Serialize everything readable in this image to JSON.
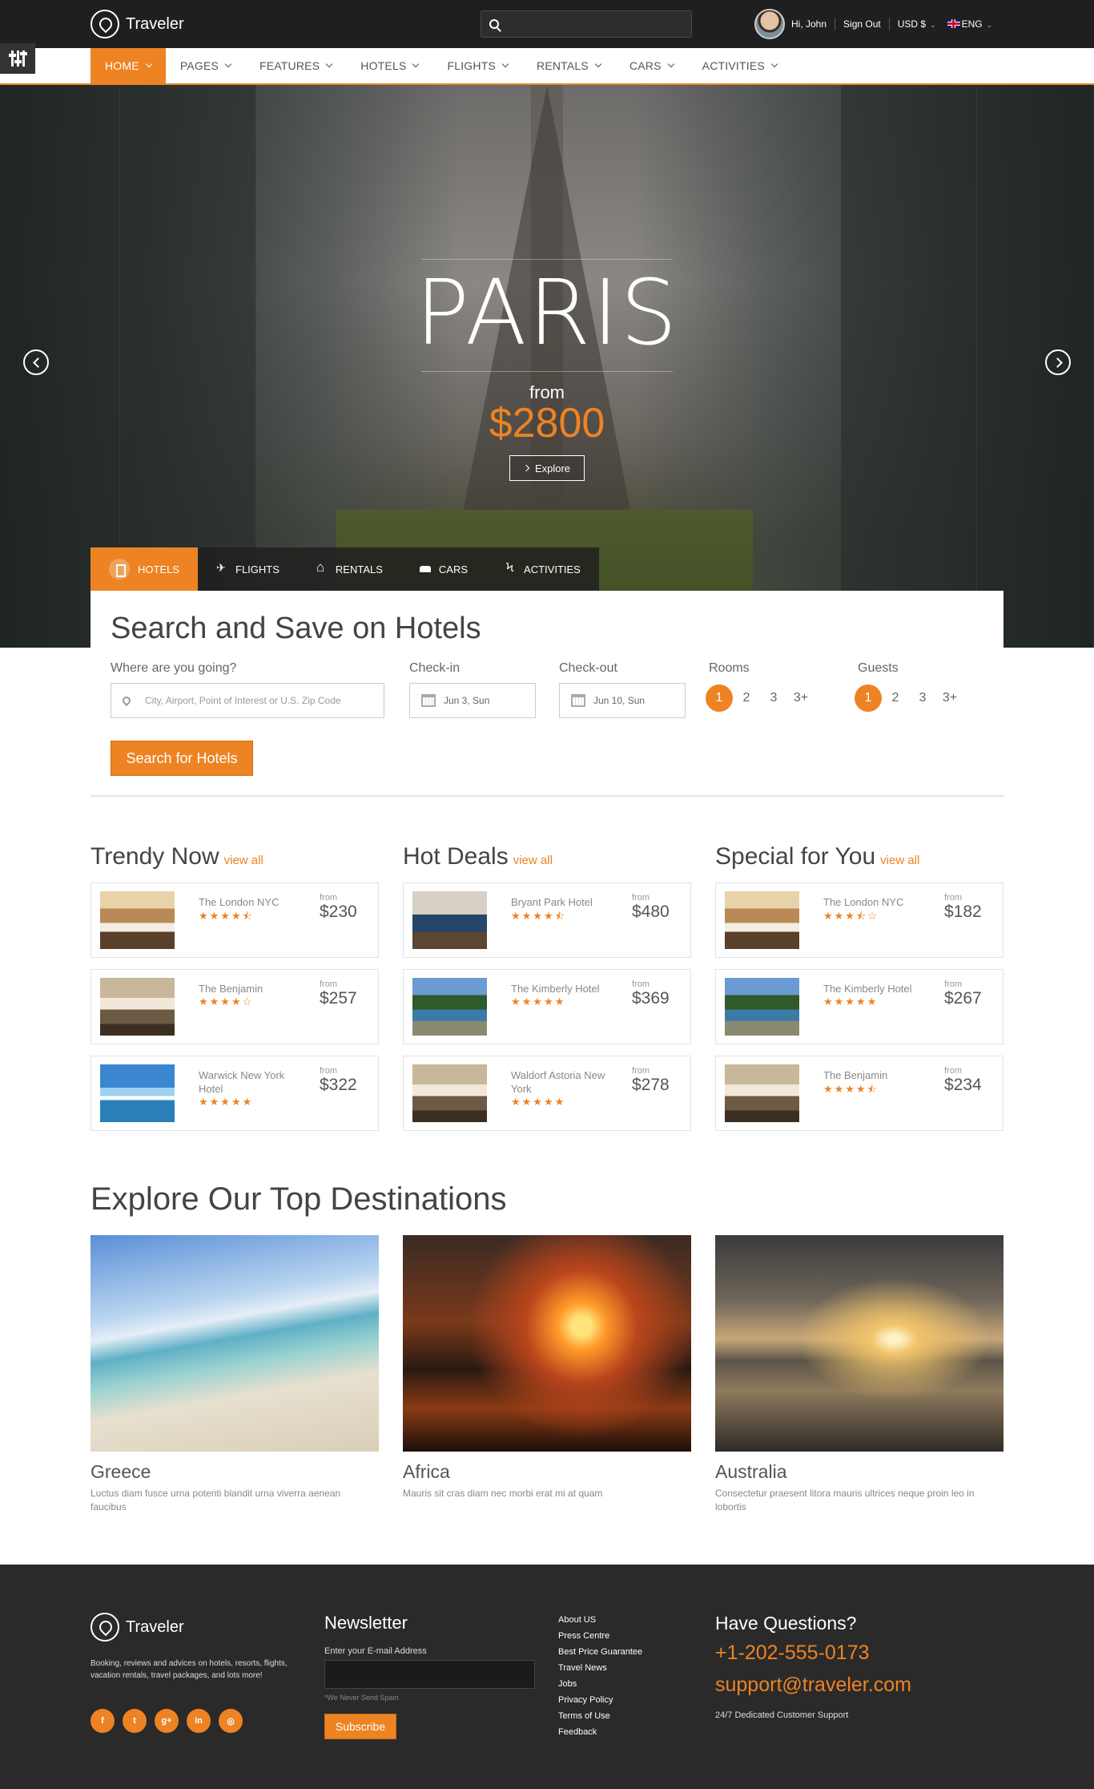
{
  "topbar": {
    "brand": "Traveler",
    "search_placeholder": "",
    "greeting": "Hi, John",
    "sign_out": "Sign Out",
    "currency": "USD $",
    "language": "ENG"
  },
  "nav": {
    "items": [
      "HOME",
      "PAGES",
      "FEATURES",
      "HOTELS",
      "FLIGHTS",
      "RENTALS",
      "CARS",
      "ACTIVITIES"
    ]
  },
  "hero": {
    "title": "PARIS",
    "from": "from",
    "price": "$2800",
    "button": "Explore"
  },
  "tabs": [
    "HOTELS",
    "FLIGHTS",
    "RENTALS",
    "CARS",
    "ACTIVITIES"
  ],
  "search": {
    "title": "Search and Save on Hotels",
    "where_label": "Where are you going?",
    "where_placeholder": "City, Airport, Point of Interest or U.S. Zip Code",
    "checkin_label": "Check-in",
    "checkin_value": "Jun 3, Sun",
    "checkout_label": "Check-out",
    "checkout_value": "Jun 10, Sun",
    "rooms_label": "Rooms",
    "rooms_options": [
      "1",
      "2",
      "3",
      "3+"
    ],
    "guests_label": "Guests",
    "guests_options": [
      "1",
      "2",
      "3",
      "3+"
    ],
    "button": "Search for Hotels"
  },
  "columns": [
    {
      "title": "Trendy Now",
      "view_all": "view all",
      "cards": [
        {
          "name": "The London NYC",
          "stars": "★★★★⯪",
          "from": "from",
          "price": "$230"
        },
        {
          "name": "The Benjamin",
          "stars": "★★★★☆",
          "from": "from",
          "price": "$257"
        },
        {
          "name": "Warwick New York Hotel",
          "stars": "★★★★★",
          "from": "from",
          "price": "$322"
        }
      ]
    },
    {
      "title": "Hot Deals",
      "view_all": "view all",
      "cards": [
        {
          "name": "Bryant Park Hotel",
          "stars": "★★★★⯪",
          "from": "from",
          "price": "$480"
        },
        {
          "name": "The Kimberly Hotel",
          "stars": "★★★★★",
          "from": "from",
          "price": "$369"
        },
        {
          "name": "Waldorf Astoria New York",
          "stars": "★★★★★",
          "from": "from",
          "price": "$278"
        }
      ]
    },
    {
      "title": "Special for You",
      "view_all": "view all",
      "cards": [
        {
          "name": "The London NYC",
          "stars": "★★★⯪☆",
          "from": "from",
          "price": "$182"
        },
        {
          "name": "The Kimberly Hotel",
          "stars": "★★★★★",
          "from": "from",
          "price": "$267"
        },
        {
          "name": "The Benjamin",
          "stars": "★★★★⯪",
          "from": "from",
          "price": "$234"
        }
      ]
    }
  ],
  "destinations": {
    "title": "Explore Our Top Destinations",
    "items": [
      {
        "name": "Greece",
        "desc": "Luctus diam fusce urna potenti blandit urna viverra aenean faucibus"
      },
      {
        "name": "Africa",
        "desc": "Mauris sit cras diam nec morbi erat mi at quam"
      },
      {
        "name": "Australia",
        "desc": "Consectetur praesent litora mauris ultrices neque proin leo in lobortis"
      }
    ]
  },
  "footer": {
    "brand": "Traveler",
    "desc": "Booking, reviews and advices on hotels, resorts, flights, vacation rentals, travel packages, and lots more!",
    "newsletter_title": "Newsletter",
    "newsletter_label": "Enter your E-mail Address",
    "newsletter_note": "*We Never Send Spam",
    "newsletter_button": "Subscribe",
    "links": [
      "About US",
      "Press Centre",
      "Best Price Guarantee",
      "Travel News",
      "Jobs",
      "Privacy Policy",
      "Terms of Use",
      "Feedback"
    ],
    "questions_title": "Have Questions?",
    "phone": "+1-202-555-0173",
    "email": "support@traveler.com",
    "support": "24/7 Dedicated Customer Support",
    "socials": [
      "f",
      "t",
      "g+",
      "in",
      "◎"
    ]
  },
  "colors": {
    "accent": "#ed8323",
    "dark": "#2a2a2a"
  }
}
